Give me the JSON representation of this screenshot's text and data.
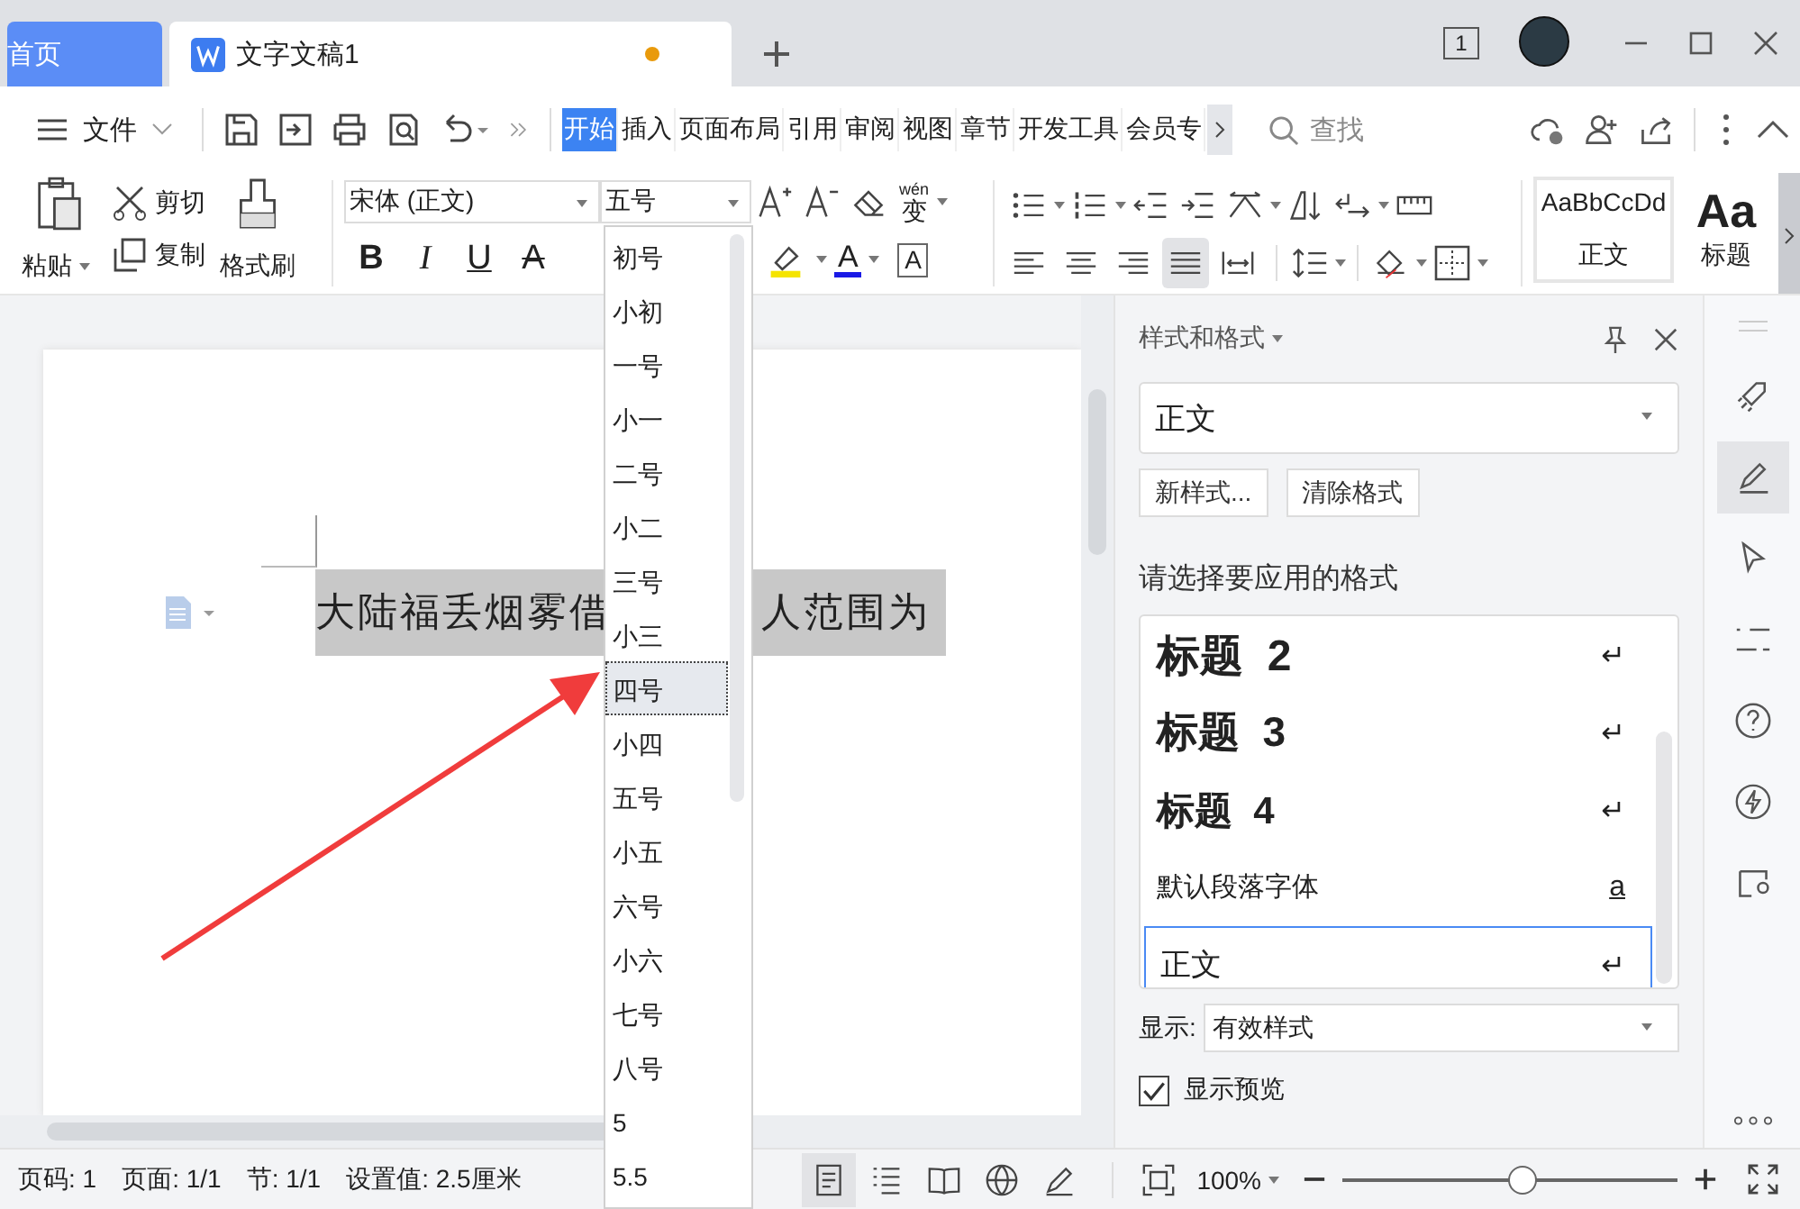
{
  "tab_bar": {
    "tabs": [
      {
        "label": "首页",
        "kind": "home",
        "selected": false,
        "unsaved": false
      },
      {
        "label": "文字文稿1",
        "kind": "document",
        "selected": true,
        "unsaved": true
      }
    ],
    "window_count": "1"
  },
  "menu": {
    "file": "文件",
    "tabs": [
      {
        "label": "开始",
        "selected": true
      },
      {
        "label": "插入",
        "selected": false
      },
      {
        "label": "页面布局",
        "selected": false
      },
      {
        "label": "引用",
        "selected": false
      },
      {
        "label": "审阅",
        "selected": false
      },
      {
        "label": "视图",
        "selected": false
      },
      {
        "label": "章节",
        "selected": false
      },
      {
        "label": "开发工具",
        "selected": false
      },
      {
        "label": "会员专",
        "selected": false
      }
    ],
    "search": {
      "placeholder": "查找"
    }
  },
  "ribbon": {
    "paste": "粘贴",
    "cut": "剪切",
    "copy": "复制",
    "format_painter": "格式刷",
    "font_family": "宋体 (正文)",
    "font_size": "五号",
    "phonetic_top": "wén",
    "phonetic_char": "变",
    "format_buttons": [
      {
        "label": "B",
        "kind": "bold"
      },
      {
        "label": "I",
        "kind": "italic"
      },
      {
        "label": "U",
        "kind": "underline"
      },
      {
        "label": "A",
        "kind": "strike"
      }
    ],
    "font_color": "A",
    "char_border": "A",
    "align_buttons": [
      {
        "selected": false
      },
      {
        "selected": false
      },
      {
        "selected": false
      },
      {
        "selected": true
      },
      {
        "selected": false
      }
    ],
    "style_gallery": [
      {
        "sample": "AaBbCcDd",
        "name": "正文",
        "kind": "body",
        "selected": true
      },
      {
        "sample": "Aa",
        "name": "标题",
        "kind": "heading",
        "selected": false
      }
    ]
  },
  "size_dropdown": [
    {
      "label": "初号",
      "selected": false
    },
    {
      "label": "小初",
      "selected": false
    },
    {
      "label": "一号",
      "selected": false
    },
    {
      "label": "小一",
      "selected": false
    },
    {
      "label": "二号",
      "selected": false
    },
    {
      "label": "小二",
      "selected": false
    },
    {
      "label": "三号",
      "selected": false
    },
    {
      "label": "小三",
      "selected": false
    },
    {
      "label": "四号",
      "selected": true
    },
    {
      "label": "小四",
      "selected": false
    },
    {
      "label": "五号",
      "selected": false
    },
    {
      "label": "小五",
      "selected": false
    },
    {
      "label": "六号",
      "selected": false
    },
    {
      "label": "小六",
      "selected": false
    },
    {
      "label": "七号",
      "selected": false
    },
    {
      "label": "八号",
      "selected": false
    },
    {
      "label": "5",
      "selected": false
    },
    {
      "label": "5.5",
      "selected": false
    }
  ],
  "document": {
    "segments": [
      "大陆福丢烟雾借",
      "人范围为"
    ]
  },
  "panel": {
    "title": "样式和格式",
    "current_style": "正文",
    "buttons": [
      "新样式...",
      "清除格式"
    ],
    "prompt": "请选择要应用的格式",
    "styles": [
      {
        "name": "标题  2",
        "kind": "heading2",
        "mark": "↵",
        "selected": false
      },
      {
        "name": "标题  3",
        "kind": "heading3",
        "mark": "↵",
        "selected": false
      },
      {
        "name": "标题  4",
        "kind": "heading4",
        "mark": "↵",
        "selected": false
      },
      {
        "name": "默认段落字体",
        "kind": "plain",
        "mark": "a",
        "selected": false
      },
      {
        "name": "正文",
        "kind": "body",
        "mark": "↵",
        "selected": true
      }
    ],
    "show_label": "显示:",
    "show_value": "有效样式",
    "preview": {
      "label": "显示预览",
      "checked": true
    }
  },
  "side_strip": [
    {
      "selected": false
    },
    {
      "selected": true
    },
    {
      "selected": false
    },
    {
      "selected": false
    },
    {
      "selected": false
    },
    {
      "selected": false
    },
    {
      "selected": false
    }
  ],
  "status_bar": {
    "items": [
      "页码: 1",
      "页面: 1/1",
      "节: 1/1",
      "设置值: 2.5厘米"
    ],
    "views": [
      {
        "selected": true
      },
      {
        "selected": false
      },
      {
        "selected": false
      },
      {
        "selected": false
      },
      {
        "selected": false
      }
    ],
    "zoom": "100%",
    "zoom_slider": {
      "level": 0.53
    }
  }
}
